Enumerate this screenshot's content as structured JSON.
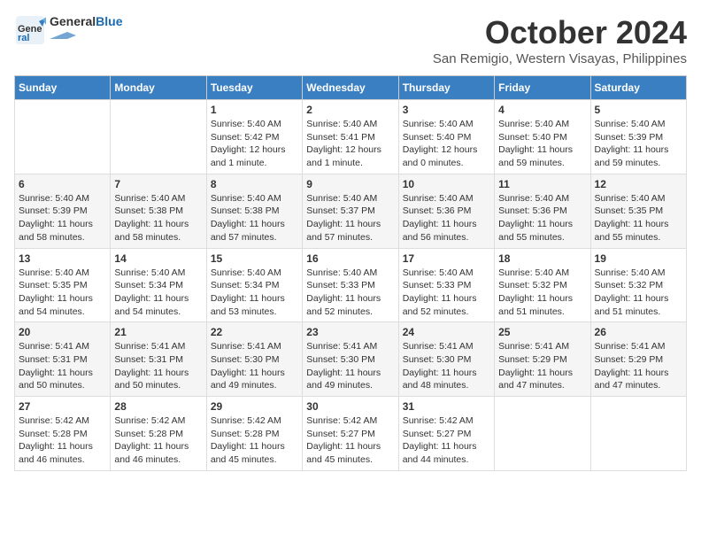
{
  "header": {
    "logo_general": "General",
    "logo_blue": "Blue",
    "month": "October 2024",
    "location": "San Remigio, Western Visayas, Philippines"
  },
  "days_of_week": [
    "Sunday",
    "Monday",
    "Tuesday",
    "Wednesday",
    "Thursday",
    "Friday",
    "Saturday"
  ],
  "weeks": [
    [
      {
        "day": "",
        "detail": ""
      },
      {
        "day": "",
        "detail": ""
      },
      {
        "day": "1",
        "detail": "Sunrise: 5:40 AM\nSunset: 5:42 PM\nDaylight: 12 hours\nand 1 minute."
      },
      {
        "day": "2",
        "detail": "Sunrise: 5:40 AM\nSunset: 5:41 PM\nDaylight: 12 hours\nand 1 minute."
      },
      {
        "day": "3",
        "detail": "Sunrise: 5:40 AM\nSunset: 5:40 PM\nDaylight: 12 hours\nand 0 minutes."
      },
      {
        "day": "4",
        "detail": "Sunrise: 5:40 AM\nSunset: 5:40 PM\nDaylight: 11 hours\nand 59 minutes."
      },
      {
        "day": "5",
        "detail": "Sunrise: 5:40 AM\nSunset: 5:39 PM\nDaylight: 11 hours\nand 59 minutes."
      }
    ],
    [
      {
        "day": "6",
        "detail": "Sunrise: 5:40 AM\nSunset: 5:39 PM\nDaylight: 11 hours\nand 58 minutes."
      },
      {
        "day": "7",
        "detail": "Sunrise: 5:40 AM\nSunset: 5:38 PM\nDaylight: 11 hours\nand 58 minutes."
      },
      {
        "day": "8",
        "detail": "Sunrise: 5:40 AM\nSunset: 5:38 PM\nDaylight: 11 hours\nand 57 minutes."
      },
      {
        "day": "9",
        "detail": "Sunrise: 5:40 AM\nSunset: 5:37 PM\nDaylight: 11 hours\nand 57 minutes."
      },
      {
        "day": "10",
        "detail": "Sunrise: 5:40 AM\nSunset: 5:36 PM\nDaylight: 11 hours\nand 56 minutes."
      },
      {
        "day": "11",
        "detail": "Sunrise: 5:40 AM\nSunset: 5:36 PM\nDaylight: 11 hours\nand 55 minutes."
      },
      {
        "day": "12",
        "detail": "Sunrise: 5:40 AM\nSunset: 5:35 PM\nDaylight: 11 hours\nand 55 minutes."
      }
    ],
    [
      {
        "day": "13",
        "detail": "Sunrise: 5:40 AM\nSunset: 5:35 PM\nDaylight: 11 hours\nand 54 minutes."
      },
      {
        "day": "14",
        "detail": "Sunrise: 5:40 AM\nSunset: 5:34 PM\nDaylight: 11 hours\nand 54 minutes."
      },
      {
        "day": "15",
        "detail": "Sunrise: 5:40 AM\nSunset: 5:34 PM\nDaylight: 11 hours\nand 53 minutes."
      },
      {
        "day": "16",
        "detail": "Sunrise: 5:40 AM\nSunset: 5:33 PM\nDaylight: 11 hours\nand 52 minutes."
      },
      {
        "day": "17",
        "detail": "Sunrise: 5:40 AM\nSunset: 5:33 PM\nDaylight: 11 hours\nand 52 minutes."
      },
      {
        "day": "18",
        "detail": "Sunrise: 5:40 AM\nSunset: 5:32 PM\nDaylight: 11 hours\nand 51 minutes."
      },
      {
        "day": "19",
        "detail": "Sunrise: 5:40 AM\nSunset: 5:32 PM\nDaylight: 11 hours\nand 51 minutes."
      }
    ],
    [
      {
        "day": "20",
        "detail": "Sunrise: 5:41 AM\nSunset: 5:31 PM\nDaylight: 11 hours\nand 50 minutes."
      },
      {
        "day": "21",
        "detail": "Sunrise: 5:41 AM\nSunset: 5:31 PM\nDaylight: 11 hours\nand 50 minutes."
      },
      {
        "day": "22",
        "detail": "Sunrise: 5:41 AM\nSunset: 5:30 PM\nDaylight: 11 hours\nand 49 minutes."
      },
      {
        "day": "23",
        "detail": "Sunrise: 5:41 AM\nSunset: 5:30 PM\nDaylight: 11 hours\nand 49 minutes."
      },
      {
        "day": "24",
        "detail": "Sunrise: 5:41 AM\nSunset: 5:30 PM\nDaylight: 11 hours\nand 48 minutes."
      },
      {
        "day": "25",
        "detail": "Sunrise: 5:41 AM\nSunset: 5:29 PM\nDaylight: 11 hours\nand 47 minutes."
      },
      {
        "day": "26",
        "detail": "Sunrise: 5:41 AM\nSunset: 5:29 PM\nDaylight: 11 hours\nand 47 minutes."
      }
    ],
    [
      {
        "day": "27",
        "detail": "Sunrise: 5:42 AM\nSunset: 5:28 PM\nDaylight: 11 hours\nand 46 minutes."
      },
      {
        "day": "28",
        "detail": "Sunrise: 5:42 AM\nSunset: 5:28 PM\nDaylight: 11 hours\nand 46 minutes."
      },
      {
        "day": "29",
        "detail": "Sunrise: 5:42 AM\nSunset: 5:28 PM\nDaylight: 11 hours\nand 45 minutes."
      },
      {
        "day": "30",
        "detail": "Sunrise: 5:42 AM\nSunset: 5:27 PM\nDaylight: 11 hours\nand 45 minutes."
      },
      {
        "day": "31",
        "detail": "Sunrise: 5:42 AM\nSunset: 5:27 PM\nDaylight: 11 hours\nand 44 minutes."
      },
      {
        "day": "",
        "detail": ""
      },
      {
        "day": "",
        "detail": ""
      }
    ]
  ]
}
